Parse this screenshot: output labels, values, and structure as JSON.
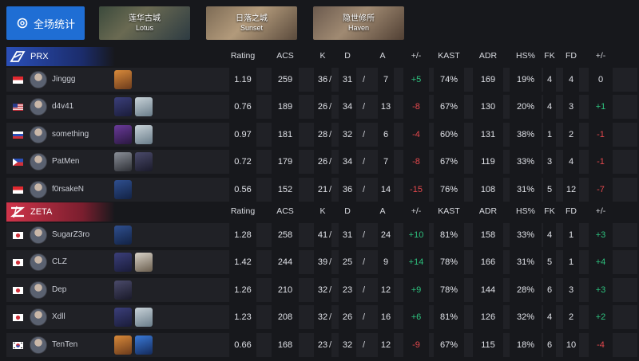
{
  "topbar": {
    "all_stats_label": "全场统计",
    "maps": [
      {
        "cn": "莲华古城",
        "en": "Lotus"
      },
      {
        "cn": "日落之城",
        "en": "Sunset"
      },
      {
        "cn": "隐世修所",
        "en": "Haven"
      }
    ]
  },
  "columns": [
    "Rating",
    "ACS",
    "K",
    "D",
    "A",
    "+/-",
    "KAST",
    "ADR",
    "HS%",
    "FK",
    "FD",
    "+/-"
  ],
  "teams": [
    {
      "name": "PRX",
      "players": [
        {
          "flag": "sg",
          "name": "Jinggg",
          "agents": [
            "raze"
          ],
          "rating": "1.19",
          "acs": "259",
          "k": "36",
          "d": "31",
          "a": "7",
          "pm": "+5",
          "kast": "74%",
          "adr": "169",
          "hs": "19%",
          "fk": "4",
          "fd": "4",
          "fpm": "0"
        },
        {
          "flag": "us",
          "name": "d4v41",
          "agents": [
            "fade",
            "sage"
          ],
          "rating": "0.76",
          "acs": "189",
          "k": "26",
          "d": "34",
          "a": "13",
          "pm": "-8",
          "kast": "67%",
          "adr": "130",
          "hs": "20%",
          "fk": "4",
          "fd": "3",
          "fpm": "+1"
        },
        {
          "flag": "ru",
          "name": "something",
          "agents": [
            "reyna",
            "sage"
          ],
          "rating": "0.97",
          "acs": "181",
          "k": "28",
          "d": "32",
          "a": "6",
          "pm": "-4",
          "kast": "60%",
          "adr": "131",
          "hs": "38%",
          "fk": "1",
          "fd": "2",
          "fpm": "-1"
        },
        {
          "flag": "ph",
          "name": "PatMen",
          "agents": [
            "cypher",
            "omen"
          ],
          "rating": "0.72",
          "acs": "179",
          "k": "26",
          "d": "34",
          "a": "7",
          "pm": "-8",
          "kast": "67%",
          "adr": "119",
          "hs": "33%",
          "fk": "3",
          "fd": "4",
          "fpm": "-1"
        },
        {
          "flag": "id",
          "name": "f0rsakeN",
          "agents": [
            "harbor"
          ],
          "rating": "0.56",
          "acs": "152",
          "k": "21",
          "d": "36",
          "a": "14",
          "pm": "-15",
          "kast": "76%",
          "adr": "108",
          "hs": "31%",
          "fk": "5",
          "fd": "12",
          "fpm": "-7"
        }
      ]
    },
    {
      "name": "ZETA",
      "players": [
        {
          "flag": "jp",
          "name": "SugarZ3ro",
          "agents": [
            "harbor"
          ],
          "rating": "1.28",
          "acs": "258",
          "k": "41",
          "d": "31",
          "a": "24",
          "pm": "+10",
          "kast": "81%",
          "adr": "158",
          "hs": "33%",
          "fk": "4",
          "fd": "1",
          "fpm": "+3"
        },
        {
          "flag": "jp",
          "name": "CLZ",
          "agents": [
            "fade",
            "chamber"
          ],
          "rating": "1.42",
          "acs": "244",
          "k": "39",
          "d": "25",
          "a": "9",
          "pm": "+14",
          "kast": "78%",
          "adr": "166",
          "hs": "31%",
          "fk": "5",
          "fd": "1",
          "fpm": "+4"
        },
        {
          "flag": "jp",
          "name": "Dep",
          "agents": [
            "omen"
          ],
          "rating": "1.26",
          "acs": "210",
          "k": "32",
          "d": "23",
          "a": "12",
          "pm": "+9",
          "kast": "78%",
          "adr": "144",
          "hs": "28%",
          "fk": "6",
          "fd": "3",
          "fpm": "+3"
        },
        {
          "flag": "jp",
          "name": "Xdll",
          "agents": [
            "fade",
            "sage"
          ],
          "rating": "1.23",
          "acs": "208",
          "k": "32",
          "d": "26",
          "a": "16",
          "pm": "+6",
          "kast": "81%",
          "adr": "126",
          "hs": "32%",
          "fk": "4",
          "fd": "2",
          "fpm": "+2"
        },
        {
          "flag": "kr",
          "name": "TenTen",
          "agents": [
            "raze",
            "neon"
          ],
          "rating": "0.66",
          "acs": "168",
          "k": "23",
          "d": "32",
          "a": "12",
          "pm": "-9",
          "kast": "67%",
          "adr": "115",
          "hs": "18%",
          "fk": "6",
          "fd": "10",
          "fpm": "-4"
        }
      ]
    }
  ],
  "colors": {
    "accent": "#1f6ed4",
    "prx": "#2a4fb8",
    "zeta": "#d0344a",
    "positive": "#2ec27e",
    "negative": "#e5484d"
  }
}
